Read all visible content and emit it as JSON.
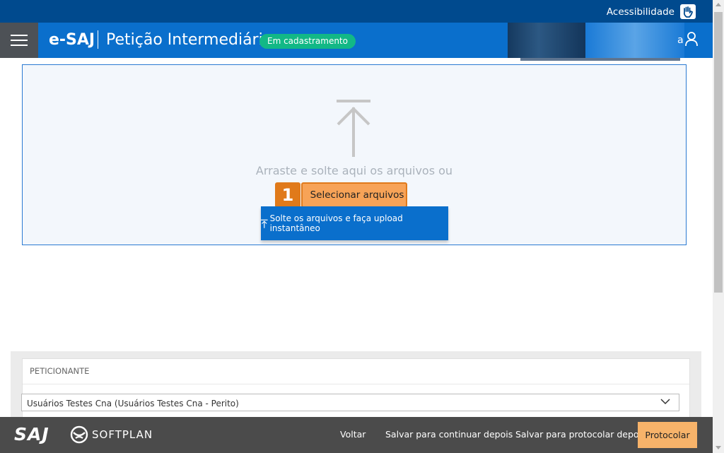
{
  "topbar": {
    "accessibility_label": "Acessibilidade",
    "accessibility_icon": "hand-sign-icon"
  },
  "header": {
    "brand": "e-SAJ",
    "title": "Petição Intermediária",
    "status_badge": "Em cadastramento",
    "user_name_suffix": "a",
    "menu_icon": "hamburger-menu-icon",
    "user_icon": "user-icon"
  },
  "dropzone": {
    "hint": "Arraste e solte aqui os arquivos ou",
    "select_button": "Selecionar arquivos",
    "step_badge": "1",
    "instant_upload_button": "Solte os arquivos e faça upload instantâneo"
  },
  "peticionante": {
    "title": "PETICIONANTE",
    "selected_value": "Usuários Testes Cna (Usuários Testes Cna - Perito)"
  },
  "footer": {
    "saj_logo": "SAJ",
    "softplan_logo": "SOFTPLAN",
    "voltar": "Voltar",
    "salvar_continuar": "Salvar para continuar depois",
    "salvar_protocolar": "Salvar para protocolar depois",
    "protocolar": "Protocolar"
  },
  "colors": {
    "topbar": "#004a8e",
    "appbar": "#0a6fcc",
    "status_badge": "#12b886",
    "highlight_orange": "#e07a1a",
    "select_button": "#f7a357",
    "footer": "#4b4b4b",
    "protocolar_button": "#f7b36a"
  }
}
